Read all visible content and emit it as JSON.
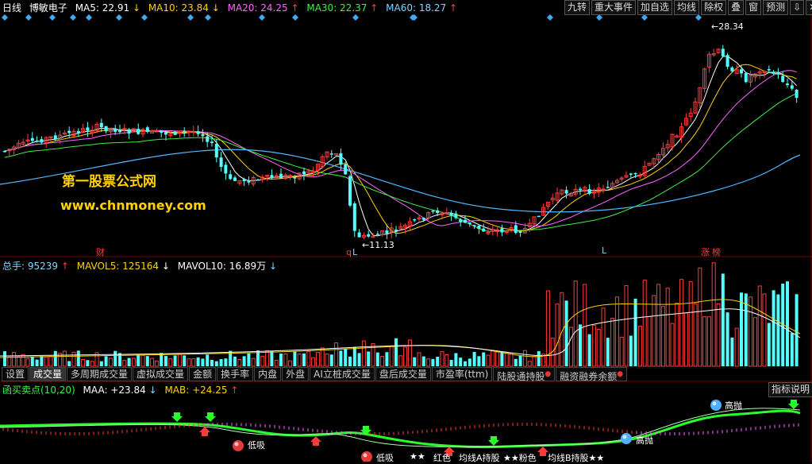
{
  "header": {
    "period": "日线",
    "stock": "博敏电子",
    "ma5": "MA5: 22.91",
    "ma10": "MA10: 23.84",
    "ma20": "MA20: 24.25",
    "ma30": "MA30: 22.37",
    "ma60": "MA60: 18.27",
    "up_arrow": "↑",
    "down_arrow": "↓"
  },
  "toolbar": {
    "items": [
      "九转",
      "重大事件",
      "加自选",
      "均线",
      "除权",
      "叠",
      "窗",
      "预测"
    ],
    "nav": "⇩",
    "close": "✕"
  },
  "price": {
    "high_label": "28.34",
    "low_label": "11.13",
    "markers": [
      "财",
      "q",
      "L",
      "L",
      "涨",
      "榜"
    ]
  },
  "watermark": {
    "title": "第一股票公式网",
    "url": "www.chnmoney.com"
  },
  "volume": {
    "total": "总手: 95239",
    "mavol5": "MAVOL5: 125164",
    "mavol10": "MAVOL10: 16.89万"
  },
  "tabs": {
    "items": [
      "设置",
      "成交量",
      "多周期成交量",
      "虚拟成交量",
      "金额",
      "换手率",
      "内盘",
      "外盘",
      "AI立桩成交量",
      "盘后成交量",
      "市盈率(ttm)",
      "陆股通持股",
      "融资融券余额"
    ],
    "active": "成交量"
  },
  "indicator": {
    "name": "函买卖点(10,20)",
    "maa": "MAA: +23.84",
    "mab": "MAB: +24.25",
    "help": "指标说明",
    "signals": {
      "low1": "低吸",
      "low2": "低吸",
      "high1": "高抛",
      "high2": "高抛",
      "stars1": "★★",
      "red": "红色",
      "hold1": "均线A持股",
      "stars2": "★★粉色",
      "hold2": "均线B持股★★"
    }
  },
  "colors": {
    "up": "#ff3b3b",
    "down": "#54ffff",
    "ma5": "#ffffff",
    "ma10": "#ffd200",
    "ma20": "#ff66ff",
    "ma30": "#3ef04a",
    "ma60": "#4fb8ff"
  }
}
